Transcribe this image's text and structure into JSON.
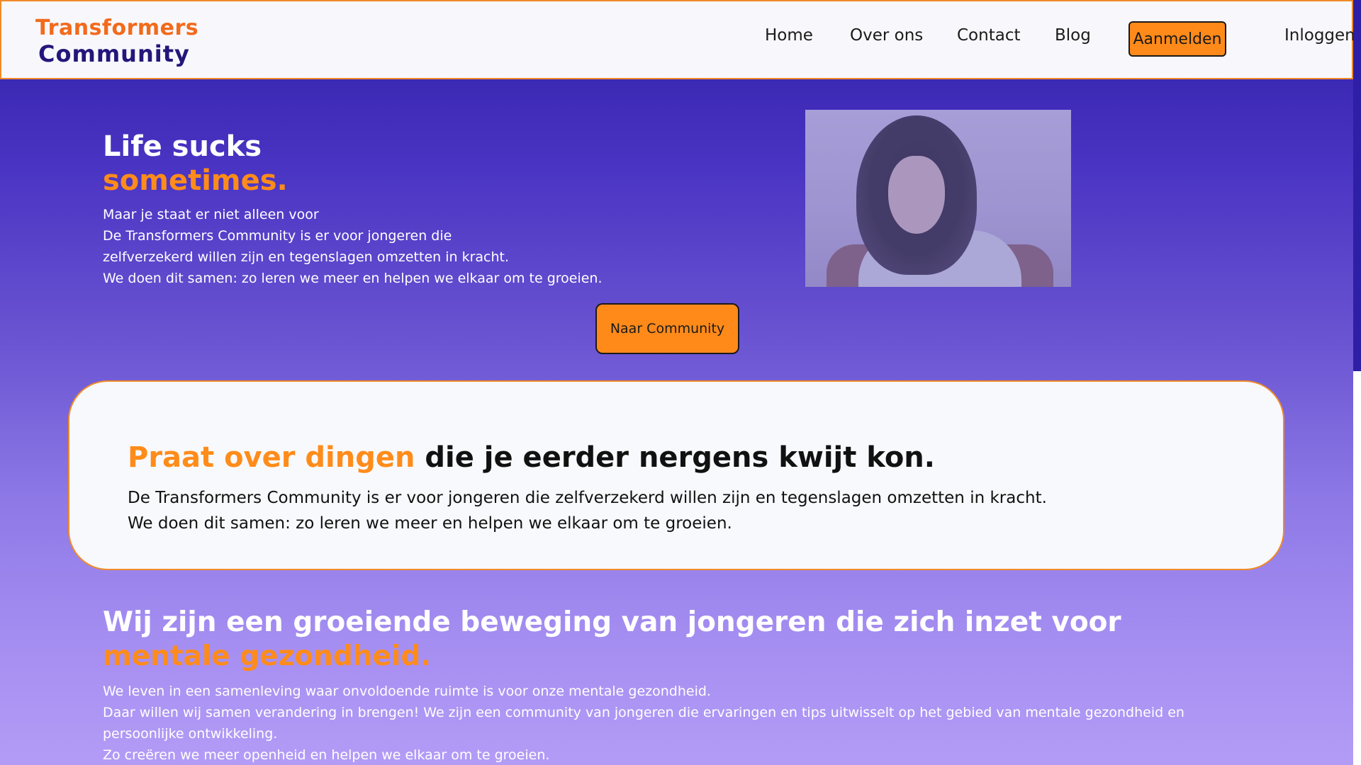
{
  "header": {
    "logo_line1": "Transformers",
    "logo_line2": "Community",
    "nav": {
      "home": "Home",
      "about": "Over ons",
      "contact": "Contact",
      "blog": "Blog",
      "signup": "Aanmelden",
      "login": "Inloggen"
    }
  },
  "hero": {
    "title_line1": "Life sucks",
    "title_line2": "sometimes.",
    "text_lines": [
      "Maar je staat er niet alleen voor",
      "De Transformers Community is er voor jongeren die",
      "zelfverzekerd willen zijn en tegenslagen omzetten in kracht.",
      "We doen dit samen: zo leren we meer en helpen we elkaar om te groeien."
    ],
    "button_label": "Naar Community"
  },
  "card": {
    "title_accent": "Praat over dingen",
    "title_rest": " die je eerder nergens kwijt kon.",
    "text_lines": [
      "De Transformers Community is er voor jongeren die zelfverzekerd willen zijn en tegenslagen omzetten in kracht.",
      "We doen dit samen: zo leren we meer en helpen we elkaar om te groeien."
    ]
  },
  "mission": {
    "title_plain": "Wij zijn een groeiende beweging van jongeren die zich inzet voor ",
    "title_accent": "mentale gezondheid.",
    "text_lines": [
      "We leven in een samenleving waar onvoldoende ruimte is voor onze mentale gezondheid.",
      "Daar willen wij samen verandering in brengen! We zijn een community van jongeren die ervaringen en tips uitwisselt op het gebied van mentale gezondheid en persoonlijke ontwikkeling.",
      "Zo creëren we meer openheid en helpen we elkaar om te groeien."
    ]
  },
  "colors": {
    "accent": "#ff8c1a",
    "brand_dark": "#24167a",
    "gradient_top": "#2e1fa6",
    "gradient_bottom": "#b39cf6"
  }
}
